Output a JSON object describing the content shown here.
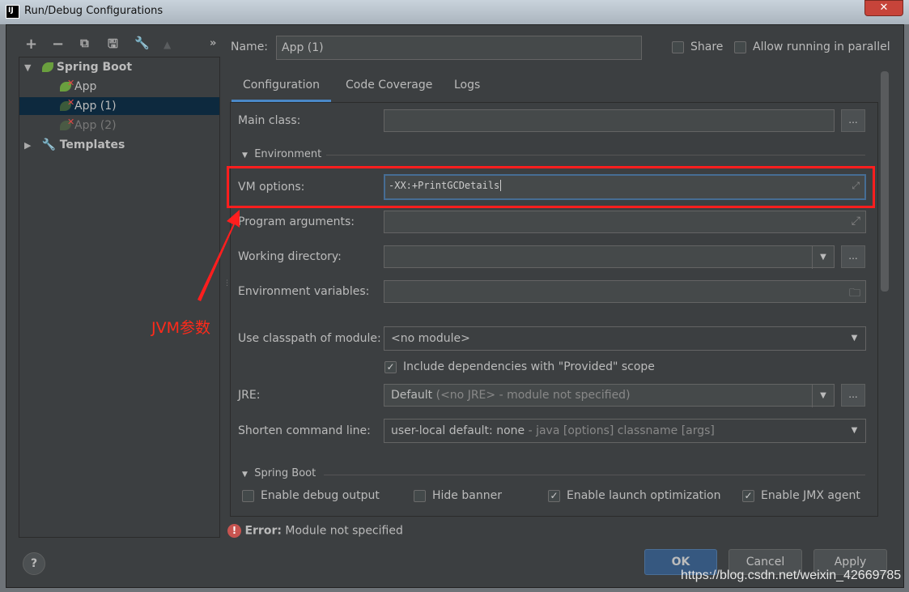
{
  "window": {
    "title": "Run/Debug Configurations",
    "logo": "IJ",
    "close": "✕"
  },
  "toolbar": {
    "add": "+",
    "remove": "−",
    "copy": "⧉",
    "save": "🖫",
    "wrench": "🔧",
    "up": "▲",
    "more": "»"
  },
  "tree": {
    "spring_boot": "Spring Boot",
    "items": [
      "App",
      "App (1)",
      "App (2)"
    ],
    "templates": "Templates"
  },
  "header": {
    "name_label": "Name:",
    "name_value": "App (1)",
    "share": "Share",
    "allow_parallel": "Allow running in parallel"
  },
  "tabs": [
    "Configuration",
    "Code Coverage",
    "Logs"
  ],
  "form": {
    "main_class": "Main class:",
    "environment": "Environment",
    "vm_options": "VM options:",
    "vm_value": "-XX:+PrintGCDetails",
    "program_args": "Program arguments:",
    "working_dir": "Working directory:",
    "env_vars": "Environment variables:",
    "classpath": "Use classpath of module:",
    "classpath_value": "<no module>",
    "include_deps": "Include dependencies with \"Provided\" scope",
    "jre": "JRE:",
    "jre_value": "Default",
    "jre_hint": " (<no JRE> - module not specified)",
    "shorten": "Shorten command line:",
    "shorten_value": "user-local default: none",
    "shorten_hint": " - java [options] classname [args]",
    "spring_boot": "Spring Boot",
    "debug_output": "Enable debug output",
    "hide_banner": "Hide banner",
    "launch_opt": "Enable launch optimization",
    "jmx": "Enable JMX agent",
    "browse": "..."
  },
  "annotation": {
    "text": "JVM参数",
    "color": "#ff2a1a"
  },
  "error": {
    "label": "Error:",
    "message": " Module not specified"
  },
  "buttons": {
    "help": "?",
    "ok": "OK",
    "cancel": "Cancel",
    "apply": "Apply"
  },
  "watermark": "https://blog.csdn.net/weixin_42669785",
  "colors": {
    "accent": "#4a88c7",
    "selection": "#0d293e",
    "background": "#3c3f41"
  }
}
